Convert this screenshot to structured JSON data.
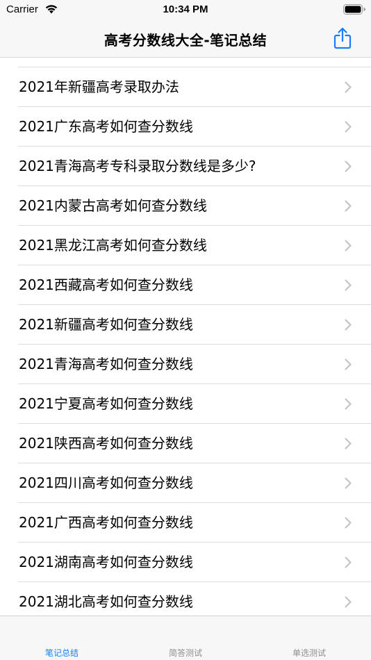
{
  "status_bar": {
    "carrier": "Carrier",
    "time": "10:34 PM"
  },
  "nav": {
    "title": "高考分数线大全-笔记总结",
    "share_icon": "share-icon",
    "accent_color": "#1a7cf6"
  },
  "list": {
    "items": [
      {
        "label": "2021年新疆高考录取办法"
      },
      {
        "label": "2021广东高考如何查分数线"
      },
      {
        "label": "2021青海高考专科录取分数线是多少?"
      },
      {
        "label": "2021内蒙古高考如何查分数线"
      },
      {
        "label": "2021黑龙江高考如何查分数线"
      },
      {
        "label": "2021西藏高考如何查分数线"
      },
      {
        "label": "2021新疆高考如何查分数线"
      },
      {
        "label": "2021青海高考如何查分数线"
      },
      {
        "label": "2021宁夏高考如何查分数线"
      },
      {
        "label": "2021陕西高考如何查分数线"
      },
      {
        "label": "2021四川高考如何查分数线"
      },
      {
        "label": "2021广西高考如何查分数线"
      },
      {
        "label": "2021湖南高考如何查分数线"
      },
      {
        "label": "2021湖北高考如何查分数线"
      }
    ]
  },
  "tab_bar": {
    "tabs": [
      {
        "label": "笔记总结",
        "selected": true
      },
      {
        "label": "简答测试",
        "selected": false
      },
      {
        "label": "单选测试",
        "selected": false
      }
    ]
  }
}
